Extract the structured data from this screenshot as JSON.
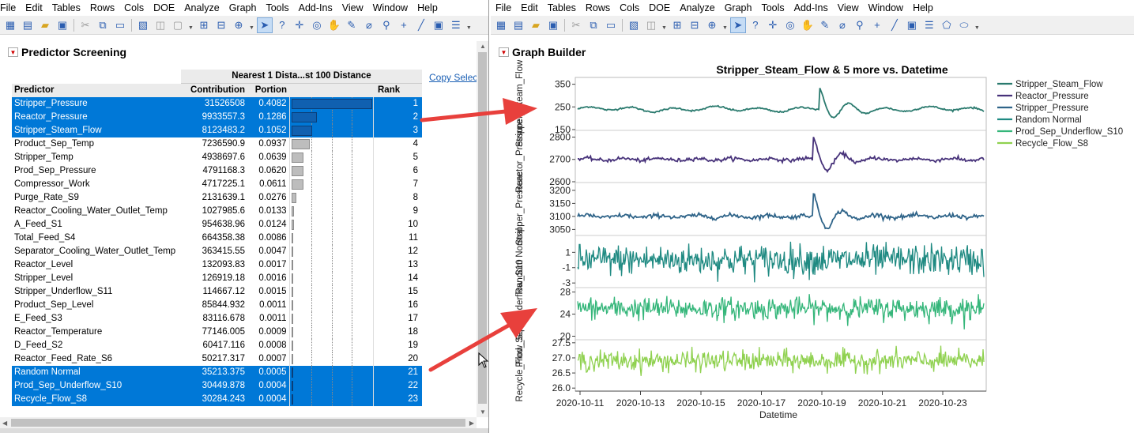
{
  "left_window": {
    "menu": [
      "File",
      "Edit",
      "Tables",
      "Rows",
      "Cols",
      "DOE",
      "Analyze",
      "Graph",
      "Tools",
      "Add-Ins",
      "View",
      "Window",
      "Help"
    ],
    "title": "Predictor Screening",
    "copy_link": "Copy Selec",
    "table": {
      "group_header": "Nearest 1 Dista...st 100 Distance",
      "headers": {
        "predictor": "Predictor",
        "contribution": "Contribution",
        "portion": "Portion",
        "rank": "Rank"
      },
      "rows": [
        {
          "name": "Stripper_Pressure",
          "contribution": "31526508",
          "portion": "0.4082",
          "rank": "1",
          "selected": true
        },
        {
          "name": "Reactor_Pressure",
          "contribution": "9933557.3",
          "portion": "0.1286",
          "rank": "2",
          "selected": true
        },
        {
          "name": "Stripper_Steam_Flow",
          "contribution": "8123483.2",
          "portion": "0.1052",
          "rank": "3",
          "selected": true
        },
        {
          "name": "Product_Sep_Temp",
          "contribution": "7236590.9",
          "portion": "0.0937",
          "rank": "4",
          "selected": false
        },
        {
          "name": "Stripper_Temp",
          "contribution": "4938697.6",
          "portion": "0.0639",
          "rank": "5",
          "selected": false
        },
        {
          "name": "Prod_Sep_Pressure",
          "contribution": "4791168.3",
          "portion": "0.0620",
          "rank": "6",
          "selected": false
        },
        {
          "name": "Compressor_Work",
          "contribution": "4717225.1",
          "portion": "0.0611",
          "rank": "7",
          "selected": false
        },
        {
          "name": "Purge_Rate_S9",
          "contribution": "2131639.1",
          "portion": "0.0276",
          "rank": "8",
          "selected": false
        },
        {
          "name": "Reactor_Cooling_Water_Outlet_Temp",
          "contribution": "1027985.6",
          "portion": "0.0133",
          "rank": "9",
          "selected": false
        },
        {
          "name": "A_Feed_S1",
          "contribution": "954638.96",
          "portion": "0.0124",
          "rank": "10",
          "selected": false
        },
        {
          "name": "Total_Feed_S4",
          "contribution": "664358.38",
          "portion": "0.0086",
          "rank": "11",
          "selected": false
        },
        {
          "name": "Separator_Cooling_Water_Outlet_Temp",
          "contribution": "363415.55",
          "portion": "0.0047",
          "rank": "12",
          "selected": false
        },
        {
          "name": "Reactor_Level",
          "contribution": "132093.83",
          "portion": "0.0017",
          "rank": "13",
          "selected": false
        },
        {
          "name": "Stripper_Level",
          "contribution": "126919.18",
          "portion": "0.0016",
          "rank": "14",
          "selected": false
        },
        {
          "name": "Stripper_Underflow_S11",
          "contribution": "114667.12",
          "portion": "0.0015",
          "rank": "15",
          "selected": false
        },
        {
          "name": "Product_Sep_Level",
          "contribution": "85844.932",
          "portion": "0.0011",
          "rank": "16",
          "selected": false
        },
        {
          "name": "E_Feed_S3",
          "contribution": "83116.678",
          "portion": "0.0011",
          "rank": "17",
          "selected": false
        },
        {
          "name": "Reactor_Temperature",
          "contribution": "77146.005",
          "portion": "0.0009",
          "rank": "18",
          "selected": false
        },
        {
          "name": "D_Feed_S2",
          "contribution": "60417.116",
          "portion": "0.0008",
          "rank": "19",
          "selected": false
        },
        {
          "name": "Reactor_Feed_Rate_S6",
          "contribution": "50217.317",
          "portion": "0.0007",
          "rank": "20",
          "selected": false
        },
        {
          "name": "Random Normal",
          "contribution": "35213.375",
          "portion": "0.0005",
          "rank": "21",
          "selected": true
        },
        {
          "name": "Prod_Sep_Underflow_S10",
          "contribution": "30449.878",
          "portion": "0.0004",
          "rank": "22",
          "selected": true
        },
        {
          "name": "Recycle_Flow_S8",
          "contribution": "30284.243",
          "portion": "0.0004",
          "rank": "23",
          "selected": true
        }
      ]
    }
  },
  "right_window": {
    "menu": [
      "File",
      "Edit",
      "Tables",
      "Rows",
      "Cols",
      "DOE",
      "Analyze",
      "Graph",
      "Tools",
      "Add-Ins",
      "View",
      "Window",
      "Help"
    ],
    "title": "Graph Builder"
  },
  "colors": {
    "selection": "#0078d7",
    "red_arrow": "#e8403c",
    "series": [
      "#2a7a6e",
      "#47327a",
      "#2f6489",
      "#1f8a82",
      "#35b67a",
      "#8fd14f"
    ]
  },
  "chart_data": {
    "type": "line",
    "title": "Stripper_Steam_Flow & 5 more vs. Datetime",
    "xlabel": "Datetime",
    "x_ticks": [
      "2020-10-11",
      "2020-10-13",
      "2020-10-15",
      "2020-10-17",
      "2020-10-19",
      "2020-10-21",
      "2020-10-23"
    ],
    "xlim": [
      "2020-10-11",
      "2020-10-24"
    ],
    "legend_position": "right",
    "panels": [
      {
        "name": "Stripper_Steam_Flow",
        "ylabel": "Stripper_Steam_Flow",
        "yticks": [
          "350",
          "250",
          "150"
        ],
        "ylim": [
          150,
          380
        ],
        "baseline": 240,
        "noise": 6,
        "color": "#2a7a6e",
        "pattern": "wave"
      },
      {
        "name": "Reactor_Pressure",
        "ylabel": "Reactor_Pressure",
        "yticks": [
          "2800",
          "2700",
          "2600"
        ],
        "ylim": [
          2600,
          2830
        ],
        "baseline": 2700,
        "noise": 4,
        "color": "#47327a",
        "pattern": "spike"
      },
      {
        "name": "Stripper_Pressure",
        "ylabel": "Stripper_Pressure",
        "yticks": [
          "3200",
          "3150",
          "3100",
          "3050"
        ],
        "ylim": [
          3030,
          3230
        ],
        "baseline": 3100,
        "noise": 4,
        "color": "#2f6489",
        "pattern": "spike"
      },
      {
        "name": "Random Normal",
        "ylabel": "Random Normal",
        "yticks": [
          "1",
          "-1",
          "-3"
        ],
        "ylim": [
          -3.5,
          3.2
        ],
        "baseline": 0,
        "noise": 1,
        "color": "#1f8a82",
        "pattern": "noise"
      },
      {
        "name": "Prod_Sep_Underflow_S10",
        "ylabel": "Prod_Sep_Underflow_S10",
        "yticks": [
          "28",
          "24",
          "20"
        ],
        "ylim": [
          19.5,
          28.8
        ],
        "baseline": 25,
        "noise": 1,
        "color": "#35b67a",
        "pattern": "noise"
      },
      {
        "name": "Recycle_Flow_S8",
        "ylabel": "Recycle_Flow_S8",
        "yticks": [
          "27.5",
          "27.0",
          "26.5",
          "26.0"
        ],
        "ylim": [
          25.9,
          27.6
        ],
        "baseline": 26.9,
        "noise": 0.17,
        "color": "#8fd14f",
        "pattern": "noise"
      }
    ],
    "legend": [
      "Stripper_Steam_Flow",
      "Reactor_Pressure",
      "Stripper_Pressure",
      "Random Normal",
      "Prod_Sep_Underflow_S10",
      "Recycle_Flow_S8"
    ]
  }
}
